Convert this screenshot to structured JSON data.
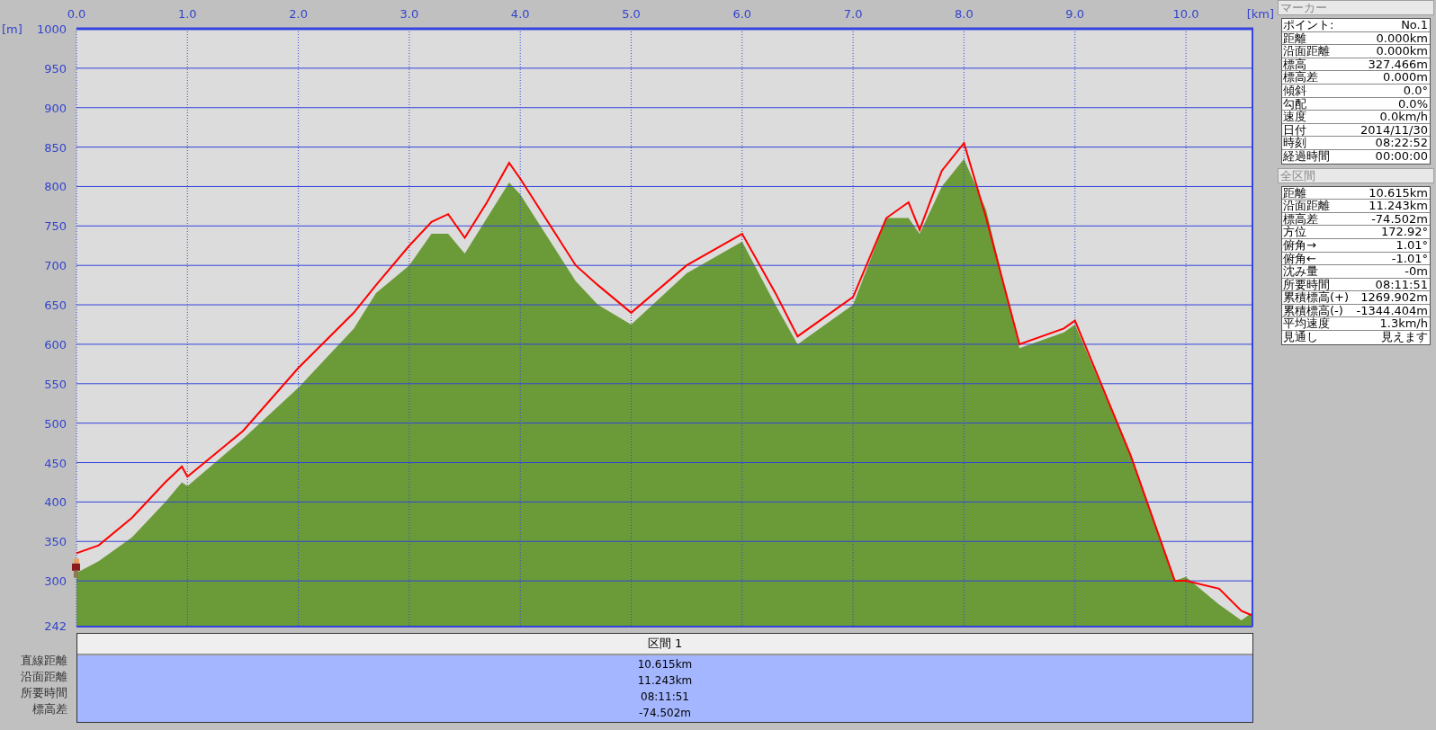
{
  "chart": {
    "chart_data": {
      "type": "area",
      "grid": true,
      "xlabel": "[km]",
      "ylabel": "[m]",
      "xlim": [
        0,
        10.6
      ],
      "ylim": [
        242,
        1000
      ],
      "xticks": [
        {
          "value": 0,
          "label": "0.0"
        },
        {
          "value": 1,
          "label": "1.0"
        },
        {
          "value": 2,
          "label": "2.0"
        },
        {
          "value": 3,
          "label": "3.0"
        },
        {
          "value": 4,
          "label": "4.0"
        },
        {
          "value": 5,
          "label": "5.0"
        },
        {
          "value": 6,
          "label": "6.0"
        },
        {
          "value": 7,
          "label": "7.0"
        },
        {
          "value": 8,
          "label": "8.0"
        },
        {
          "value": 9,
          "label": "9.0"
        },
        {
          "value": 10,
          "label": "10.0"
        }
      ],
      "yticks": [
        242,
        300,
        350,
        400,
        450,
        500,
        550,
        600,
        650,
        700,
        750,
        800,
        850,
        900,
        950,
        1000
      ],
      "x": [
        0,
        0.2,
        0.5,
        0.8,
        0.95,
        1.0,
        1.5,
        2.0,
        2.5,
        2.7,
        3.0,
        3.2,
        3.35,
        3.5,
        3.7,
        3.9,
        4.0,
        4.5,
        4.7,
        5.0,
        5.5,
        6.0,
        6.3,
        6.5,
        7.0,
        7.3,
        7.5,
        7.6,
        7.8,
        8.0,
        8.2,
        8.5,
        8.9,
        9.0,
        9.5,
        9.9,
        10.0,
        10.3,
        10.5,
        10.6
      ],
      "series": [
        {
          "color": "#6b9b38",
          "values": [
            310,
            325,
            355,
            400,
            425,
            420,
            480,
            545,
            620,
            665,
            700,
            740,
            740,
            715,
            760,
            805,
            790,
            680,
            650,
            625,
            690,
            730,
            650,
            600,
            650,
            760,
            760,
            740,
            800,
            835,
            770,
            595,
            615,
            625,
            460,
            300,
            305,
            270,
            250,
            260
          ]
        },
        {
          "type": "line",
          "color": "#ff0000",
          "values": [
            335,
            345,
            380,
            425,
            445,
            432,
            490,
            570,
            640,
            675,
            725,
            755,
            765,
            735,
            780,
            830,
            810,
            700,
            675,
            640,
            700,
            740,
            665,
            610,
            660,
            760,
            780,
            745,
            820,
            855,
            760,
            600,
            620,
            630,
            460,
            300,
            300,
            290,
            262,
            256
          ]
        }
      ]
    }
  },
  "section_table": {
    "header": "区間 1",
    "rows": [
      {
        "label": "直線距離",
        "value": "10.615km"
      },
      {
        "label": "沿面距離",
        "value": "11.243km"
      },
      {
        "label": "所要時間",
        "value": "08:11:51"
      },
      {
        "label": "標高差",
        "value": "-74.502m"
      }
    ]
  },
  "marker_panel": {
    "title": "マーカー",
    "rows": [
      {
        "label": "ポイント:",
        "value": "No.1"
      },
      {
        "label": "距離",
        "value": "0.000km"
      },
      {
        "label": "沿面距離",
        "value": "0.000km"
      },
      {
        "label": "標高",
        "value": "327.466m"
      },
      {
        "label": "標高差",
        "value": "0.000m"
      },
      {
        "label": "傾斜",
        "value": "0.0°"
      },
      {
        "label": "勾配",
        "value": "0.0%"
      },
      {
        "label": "速度",
        "value": "0.0km/h"
      },
      {
        "label": "日付",
        "value": "2014/11/30"
      },
      {
        "label": "時刻",
        "value": "08:22:52"
      },
      {
        "label": "経過時間",
        "value": "00:00:00"
      }
    ]
  },
  "total_panel": {
    "title": "全区間",
    "rows": [
      {
        "label": "距離",
        "value": "10.615km"
      },
      {
        "label": "沿面距離",
        "value": "11.243km"
      },
      {
        "label": "標高差",
        "value": "-74.502m"
      },
      {
        "label": "方位",
        "value": "172.92°"
      },
      {
        "label": "俯角→",
        "value": "1.01°"
      },
      {
        "label": "俯角←",
        "value": "-1.01°"
      },
      {
        "label": "沈み量",
        "value": "-0m"
      },
      {
        "label": "所要時間",
        "value": "08:11:51"
      },
      {
        "label": "累積標高(+)",
        "value": "1269.902m"
      },
      {
        "label": "累積標高(-)",
        "value": "-1344.404m"
      },
      {
        "label": "平均速度",
        "value": "1.3km/h"
      },
      {
        "label": "見通し",
        "value": "見えます"
      }
    ]
  }
}
